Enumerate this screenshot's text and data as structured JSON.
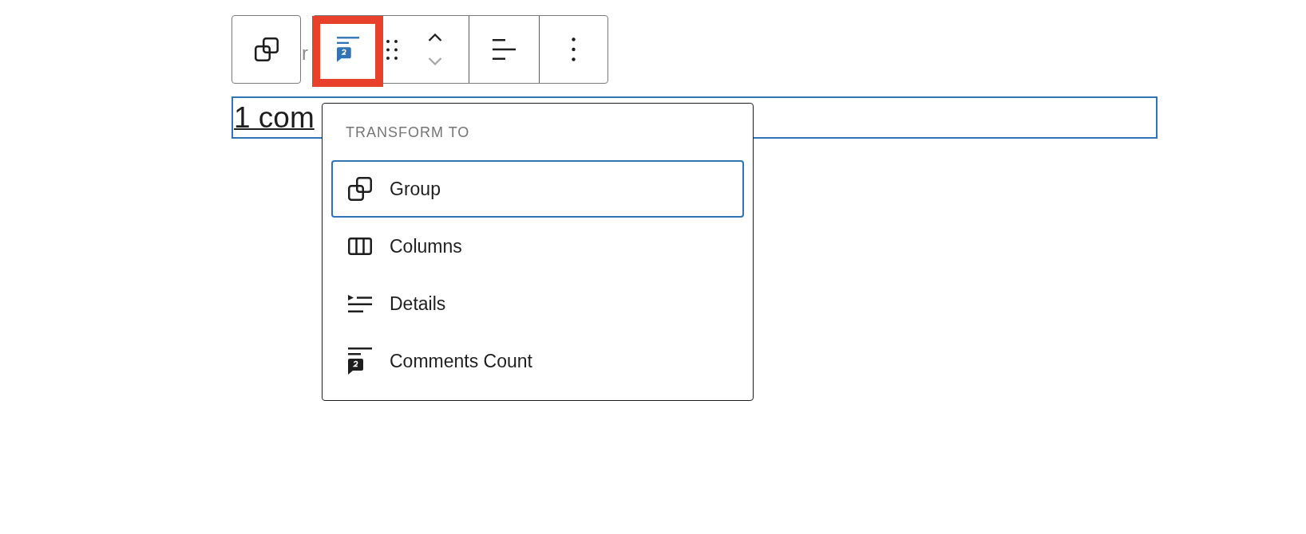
{
  "toolbar": {
    "partial_text": "r",
    "block_switcher": {
      "highlighted": true
    },
    "movers": [
      {
        "kind": "up",
        "disabled": false
      },
      {
        "kind": "down",
        "disabled": true
      }
    ]
  },
  "block": {
    "selected": true,
    "text": "1 com"
  },
  "menu": {
    "title": "TRANSFORM TO",
    "items": [
      {
        "kind": "group",
        "label": "Group",
        "selected": true
      },
      {
        "kind": "columns",
        "label": "Columns",
        "selected": false
      },
      {
        "kind": "details",
        "label": "Details",
        "selected": false
      },
      {
        "kind": "comments-count",
        "label": "Comments Count",
        "selected": false
      }
    ]
  }
}
